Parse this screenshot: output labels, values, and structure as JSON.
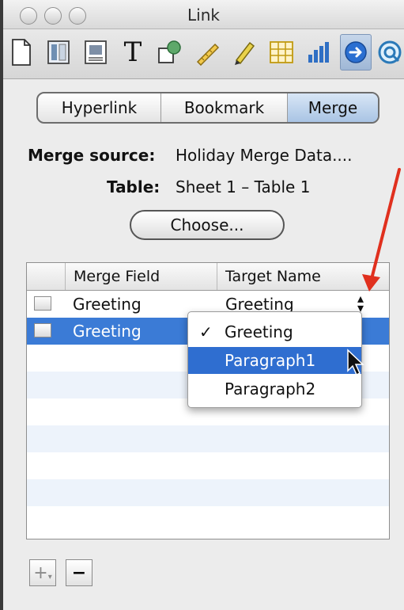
{
  "window": {
    "title": "Link"
  },
  "toolbar": {
    "tools": [
      {
        "name": "document-icon"
      },
      {
        "name": "layout-icon"
      },
      {
        "name": "wrap-icon"
      },
      {
        "name": "text-icon",
        "glyph": "T"
      },
      {
        "name": "shapes-icon"
      },
      {
        "name": "graphic-icon"
      },
      {
        "name": "table-icon"
      },
      {
        "name": "chart-icon"
      },
      {
        "name": "link-icon",
        "active": true
      },
      {
        "name": "quicktime-icon"
      }
    ]
  },
  "tabs": {
    "hyperlink": "Hyperlink",
    "bookmark": "Bookmark",
    "merge": "Merge",
    "selected": "merge"
  },
  "merge_source": {
    "label": "Merge source:",
    "value": "Holiday Merge Data...."
  },
  "table_field": {
    "label": "Table:",
    "value": "Sheet 1 – Table 1"
  },
  "choose_button": "Choose...",
  "grid": {
    "columns": [
      "Merge Field",
      "Target Name"
    ],
    "rows": [
      {
        "merge_field": "Greeting",
        "target_name": "Greeting"
      },
      {
        "merge_field": "Greeting",
        "target_name": ""
      }
    ]
  },
  "dropdown": {
    "items": [
      "Greeting",
      "Paragraph1",
      "Paragraph2"
    ],
    "checked": "Greeting",
    "highlighted": "Paragraph1",
    "check_mark": "✓"
  },
  "buttons": {
    "add": "+",
    "remove": "−"
  },
  "colors": {
    "selection": "#3b7bd6",
    "menu_highlight": "#2f6ed0",
    "annotation_arrow": "#e0301e",
    "stripe": "#edf3fb"
  }
}
